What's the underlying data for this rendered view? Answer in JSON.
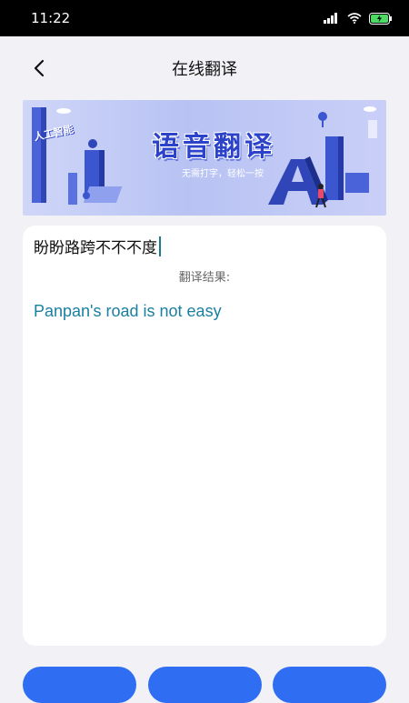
{
  "status_bar": {
    "time": "11:22"
  },
  "header": {
    "title": "在线翻译"
  },
  "banner": {
    "title": "语音翻译",
    "subtitle": "无需打字，轻松一按",
    "tag": "人工智能"
  },
  "translation": {
    "source_text": "盼盼路跨不不不度",
    "result_label": "翻译结果:",
    "result_text": "Panpan's road is not easy"
  },
  "colors": {
    "accent": "#2f6ef2",
    "result_text": "#1a7fa0",
    "banner_title": "#2c43c9"
  }
}
